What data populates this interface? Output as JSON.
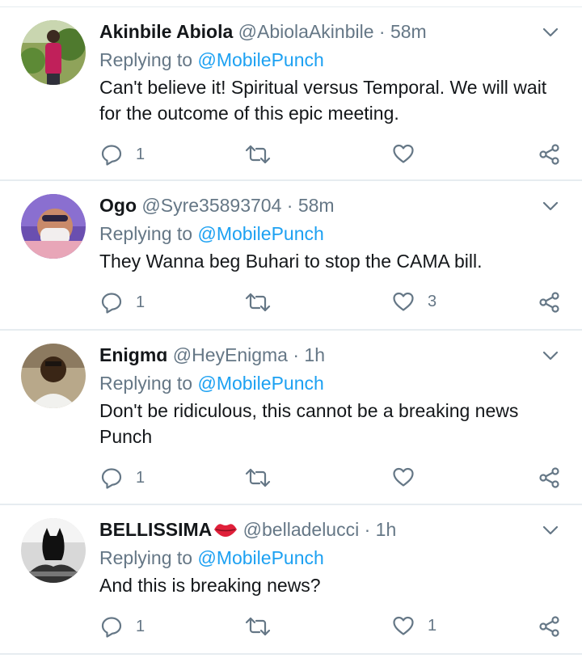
{
  "tweets": [
    {
      "name": "Akinbile Abiola",
      "handle": "@AbiolaAkinbile",
      "time": "58m",
      "replying_prefix": "Replying to",
      "replying_to": "@MobilePunch",
      "text": "Can't believe it! Spiritual versus Temporal. We will wait for the outcome of this epic meeting.",
      "replies": "1",
      "retweets": "",
      "likes": ""
    },
    {
      "name": "Ogo",
      "handle": "@Syre35893704",
      "time": "58m",
      "replying_prefix": "Replying to",
      "replying_to": "@MobilePunch",
      "text": "They Wanna beg Buhari to stop the CAMA bill.",
      "replies": "1",
      "retweets": "",
      "likes": "3"
    },
    {
      "name": "Enigmɑ",
      "handle": "@HeyEnigma",
      "time": "1h",
      "replying_prefix": "Replying to",
      "replying_to": "@MobilePunch",
      "text": "Don't be ridiculous, this cannot be a breaking news Punch",
      "replies": "1",
      "retweets": "",
      "likes": ""
    },
    {
      "name": "BELLISSIMA",
      "handle": "@belladelucci",
      "time": "1h",
      "replying_prefix": "Replying to",
      "replying_to": "@MobilePunch",
      "text": "And this is breaking news?",
      "replies": "1",
      "retweets": "",
      "likes": "1"
    }
  ],
  "separator": "·",
  "icons": {
    "reply": "reply-icon",
    "retweet": "retweet-icon",
    "like": "heart-icon",
    "share": "share-icon",
    "menu": "chevron-down-icon",
    "emoji": "lips-emoji-icon"
  },
  "colors": {
    "text": "#14171a",
    "secondary": "#657786",
    "accent": "#1da1f2",
    "divider": "#e6ecf0"
  }
}
